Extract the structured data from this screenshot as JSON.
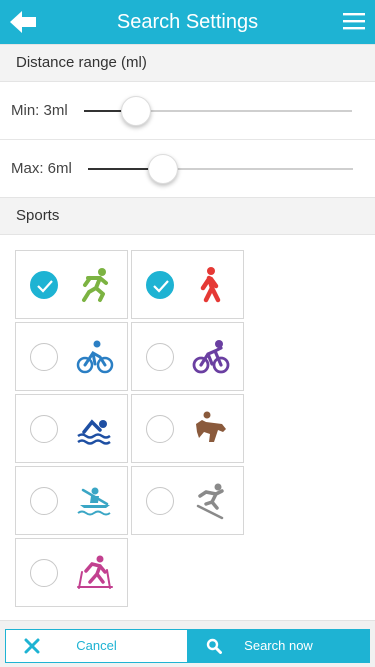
{
  "header": {
    "title": "Search Settings"
  },
  "distance": {
    "section_title": "Distance range (ml)",
    "min": {
      "label": "Min: 3ml",
      "position": 0.19
    },
    "max": {
      "label": "Max: 6ml",
      "position": 0.28
    }
  },
  "sports": {
    "section_title": "Sports",
    "items": [
      {
        "icon": "running-icon",
        "selected": true,
        "color": "#7cb342"
      },
      {
        "icon": "walking-icon",
        "selected": true,
        "color": "#e53935"
      },
      {
        "icon": "cycling-icon",
        "selected": false,
        "color": "#2b7fc4"
      },
      {
        "icon": "mountain-biking-icon",
        "selected": false,
        "color": "#6a3fa1"
      },
      {
        "icon": "swimming-icon",
        "selected": false,
        "color": "#1e4fa3"
      },
      {
        "icon": "horse-riding-icon",
        "selected": false,
        "color": "#8a5a3c"
      },
      {
        "icon": "kayaking-icon",
        "selected": false,
        "color": "#3aa6c5"
      },
      {
        "icon": "skiing-icon",
        "selected": false,
        "color": "#8a8a8a"
      },
      {
        "icon": "cross-country-skiing-icon",
        "selected": false,
        "color": "#c2408f"
      }
    ]
  },
  "footer": {
    "cancel_label": "Cancel",
    "search_label": "Search now"
  },
  "colors": {
    "accent": "#1eb3d3"
  }
}
